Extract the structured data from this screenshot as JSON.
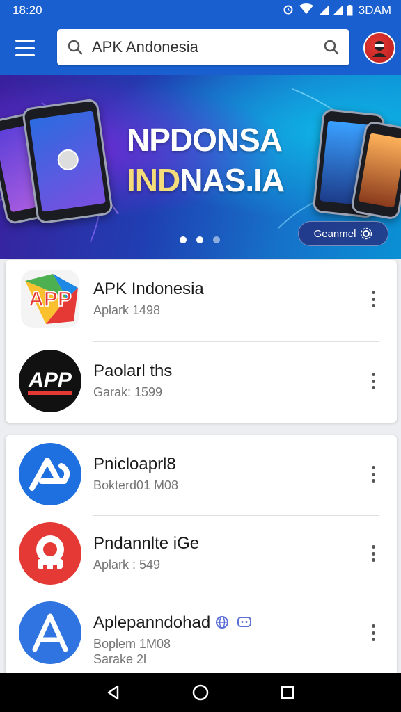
{
  "status_bar": {
    "time": "18:20",
    "right_time": "3DAM"
  },
  "search": {
    "value": "APK Andonesia"
  },
  "banner": {
    "title_line1": "NPDONSA",
    "title_line2_gold": "IND",
    "title_line2_white": "NAS.IA",
    "button_label": "Geanmel",
    "pages": 3,
    "active_page": 1
  },
  "apps": [
    {
      "title": "APK Indonesia",
      "subtitle": "Aplark 1498",
      "icon": "app-logo-icon-colorful"
    },
    {
      "title": "Paolarl ths",
      "subtitle": "Garak: 1599",
      "icon": "app-logo-icon-black"
    },
    {
      "title": "Pnicloaprl8",
      "subtitle": "Bokterd01 M08",
      "icon": "app-store-icon-blue"
    },
    {
      "title": "Pndannlte iGe",
      "subtitle": "Aplark : 549",
      "icon": "robot-icon-red"
    },
    {
      "title": "Aplepanndohad",
      "subtitle": "Boplem 1M08",
      "subtitle2": "Sarake 2l",
      "icon": "app-store-icon-blue-2",
      "badges": [
        "globe-icon",
        "chat-icon"
      ]
    }
  ],
  "colors": {
    "primary": "#1a5fd0",
    "nav": "#000000",
    "background": "#eceef1"
  }
}
